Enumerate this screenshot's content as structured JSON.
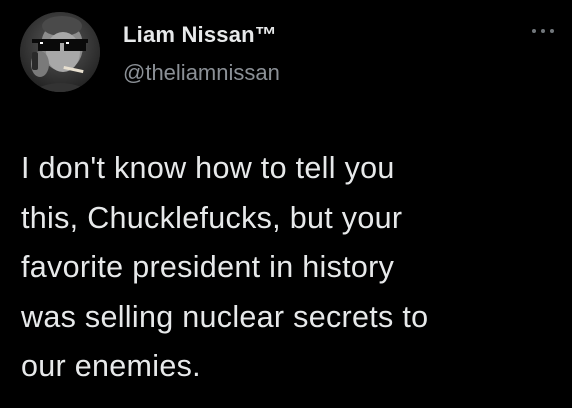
{
  "tweet": {
    "author": {
      "display_name": "Liam Nissan™",
      "handle": "@theliamnissan",
      "avatar_icon": "profile-photo-sunglasses-cigar"
    },
    "more_icon": "ellipsis-icon",
    "text_lines": [
      "I don't know how to tell you",
      "this, Chucklefucks, but your",
      "favorite president in history",
      "was selling nuclear secrets to",
      "our enemies."
    ]
  },
  "colors": {
    "background": "#000000",
    "primary_text": "#e7e9ea",
    "secondary_text": "#8b9096"
  }
}
